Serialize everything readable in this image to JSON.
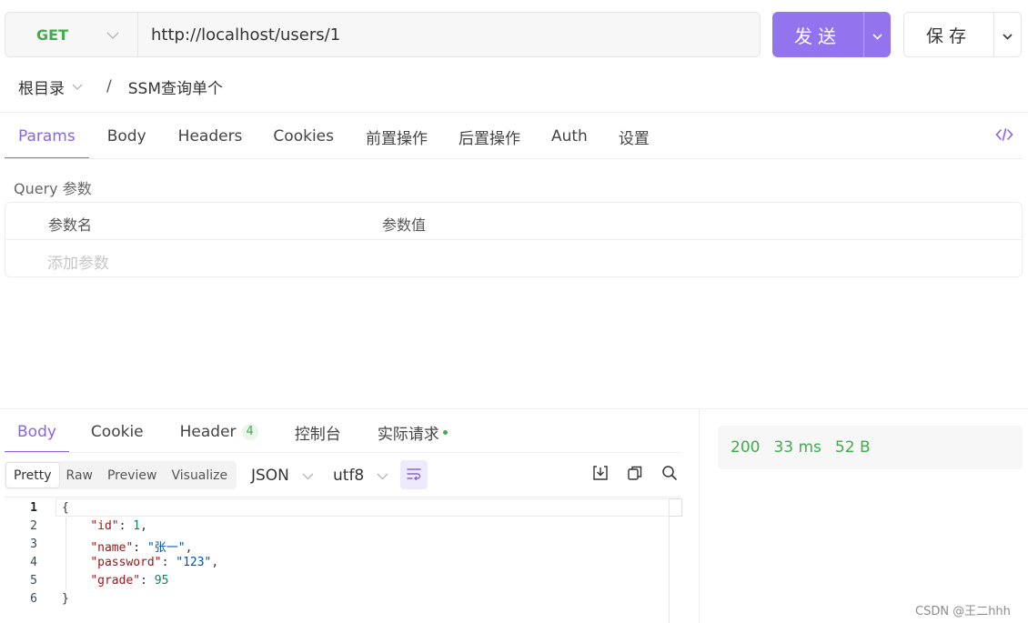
{
  "request": {
    "method": "GET",
    "url": "http://localhost/users/1",
    "send_label": "发送",
    "save_label": "保存"
  },
  "breadcrumb": {
    "root": "根目录",
    "separator": "/",
    "current": "SSM查询单个"
  },
  "request_tabs": [
    "Params",
    "Body",
    "Headers",
    "Cookies",
    "前置操作",
    "后置操作",
    "Auth",
    "设置"
  ],
  "request_tabs_active": "Params",
  "query": {
    "label": "Query 参数",
    "col_name": "参数名",
    "col_value": "参数值",
    "add_placeholder": "添加参数"
  },
  "response_tabs": {
    "body": "Body",
    "cookie": "Cookie",
    "header": "Header",
    "header_count": "4",
    "console": "控制台",
    "actual_request": "实际请求"
  },
  "format_modes": [
    "Pretty",
    "Raw",
    "Preview",
    "Visualize"
  ],
  "format_active": "Pretty",
  "content_type": "JSON",
  "encoding": "utf8",
  "response_body": {
    "line_numbers": [
      "1",
      "2",
      "3",
      "4",
      "5",
      "6"
    ],
    "open_brace": "{",
    "close_brace": "}",
    "fields": [
      {
        "key": "\"id\"",
        "value": "1",
        "type": "number",
        "trail": ","
      },
      {
        "key": "\"name\"",
        "value": "\"张一\"",
        "type": "string",
        "trail": ","
      },
      {
        "key": "\"password\"",
        "value": "\"123\"",
        "type": "string",
        "trail": ","
      },
      {
        "key": "\"grade\"",
        "value": "95",
        "type": "number",
        "trail": ""
      }
    ]
  },
  "status": {
    "code": "200",
    "time": "33 ms",
    "size": "52 B"
  },
  "watermark": "CSDN @王二hhh",
  "colors": {
    "accent": "#8a63e6",
    "send_button": "#9373ee",
    "method_get": "#3fae49",
    "status_ok": "#3fae49"
  },
  "icons": {
    "method_dropdown": "chevron-down-icon",
    "send_dropdown": "chevron-down-icon",
    "save_dropdown": "chevron-down-icon",
    "code_view": "code-icon",
    "wrap": "word-wrap-icon",
    "download": "download-icon",
    "copy": "copy-icon",
    "search": "search-icon"
  }
}
